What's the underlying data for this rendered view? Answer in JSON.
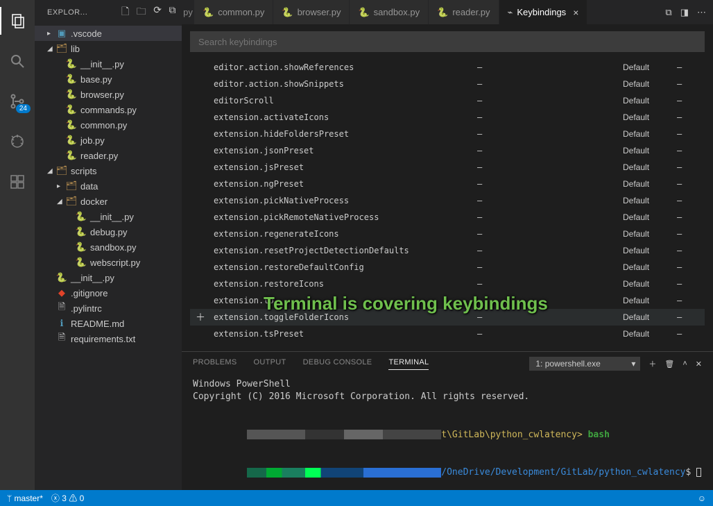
{
  "activityBar": {
    "badge": "24"
  },
  "sidebar": {
    "title": "EXPLOR...",
    "tree": [
      {
        "depth": 1,
        "chev": "▸",
        "icon": "folder-settings",
        "label": ".vscode",
        "sel": true,
        "iconColor": "#519aba"
      },
      {
        "depth": 1,
        "chev": "◢",
        "icon": "folder",
        "label": "lib"
      },
      {
        "depth": 2,
        "chev": "",
        "icon": "py",
        "label": "__init__.py"
      },
      {
        "depth": 2,
        "chev": "",
        "icon": "py",
        "label": "base.py"
      },
      {
        "depth": 2,
        "chev": "",
        "icon": "py",
        "label": "browser.py"
      },
      {
        "depth": 2,
        "chev": "",
        "icon": "py",
        "label": "commands.py"
      },
      {
        "depth": 2,
        "chev": "",
        "icon": "py",
        "label": "common.py"
      },
      {
        "depth": 2,
        "chev": "",
        "icon": "py",
        "label": "job.py"
      },
      {
        "depth": 2,
        "chev": "",
        "icon": "py",
        "label": "reader.py"
      },
      {
        "depth": 1,
        "chev": "◢",
        "icon": "folder",
        "label": "scripts"
      },
      {
        "depth": 2,
        "chev": "▸",
        "icon": "folder",
        "label": "data"
      },
      {
        "depth": 2,
        "chev": "◢",
        "icon": "folder",
        "label": "docker"
      },
      {
        "depth": 3,
        "chev": "",
        "icon": "py",
        "label": "__init__.py"
      },
      {
        "depth": 3,
        "chev": "",
        "icon": "py",
        "label": "debug.py"
      },
      {
        "depth": 3,
        "chev": "",
        "icon": "py",
        "label": "sandbox.py"
      },
      {
        "depth": 3,
        "chev": "",
        "icon": "py",
        "label": "webscript.py"
      },
      {
        "depth": 1,
        "chev": "",
        "icon": "py",
        "label": "__init__.py"
      },
      {
        "depth": 1,
        "chev": "",
        "icon": "git",
        "label": ".gitignore",
        "iconColor": "#e24329"
      },
      {
        "depth": 1,
        "chev": "",
        "icon": "file",
        "label": ".pylintrc"
      },
      {
        "depth": 1,
        "chev": "",
        "icon": "readme",
        "label": "README.md",
        "iconColor": "#519aba"
      },
      {
        "depth": 1,
        "chev": "",
        "icon": "file",
        "label": "requirements.txt"
      }
    ]
  },
  "tabs": {
    "scrollHint": "py",
    "items": [
      {
        "label": "common.py",
        "icon": "py",
        "active": false
      },
      {
        "label": "browser.py",
        "icon": "py",
        "active": false
      },
      {
        "label": "sandbox.py",
        "icon": "py",
        "active": false
      },
      {
        "label": "reader.py",
        "icon": "py",
        "active": false
      },
      {
        "label": "Keybindings",
        "icon": "kb",
        "active": true,
        "closable": true
      }
    ]
  },
  "keybindings": {
    "searchPlaceholder": "Search keybindings",
    "rows": [
      {
        "cmd": "editor.action.showReferences",
        "key": "—",
        "src": "Default",
        "when": "—"
      },
      {
        "cmd": "editor.action.showSnippets",
        "key": "—",
        "src": "Default",
        "when": "—"
      },
      {
        "cmd": "editorScroll",
        "key": "—",
        "src": "Default",
        "when": "—"
      },
      {
        "cmd": "extension.activateIcons",
        "key": "—",
        "src": "Default",
        "when": "—"
      },
      {
        "cmd": "extension.hideFoldersPreset",
        "key": "—",
        "src": "Default",
        "when": "—"
      },
      {
        "cmd": "extension.jsonPreset",
        "key": "—",
        "src": "Default",
        "when": "—"
      },
      {
        "cmd": "extension.jsPreset",
        "key": "—",
        "src": "Default",
        "when": "—"
      },
      {
        "cmd": "extension.ngPreset",
        "key": "—",
        "src": "Default",
        "when": "—"
      },
      {
        "cmd": "extension.pickNativeProcess",
        "key": "—",
        "src": "Default",
        "when": "—"
      },
      {
        "cmd": "extension.pickRemoteNativeProcess",
        "key": "—",
        "src": "Default",
        "when": "—"
      },
      {
        "cmd": "extension.regenerateIcons",
        "key": "—",
        "src": "Default",
        "when": "—"
      },
      {
        "cmd": "extension.resetProjectDetectionDefaults",
        "key": "—",
        "src": "Default",
        "when": "—"
      },
      {
        "cmd": "extension.restoreDefaultConfig",
        "key": "—",
        "src": "Default",
        "when": "—"
      },
      {
        "cmd": "extension.restoreIcons",
        "key": "—",
        "src": "Default",
        "when": "—"
      },
      {
        "cmd": "extension.to",
        "key": "—",
        "src": "Default",
        "when": "—"
      },
      {
        "cmd": "extension.toggleFolderIcons",
        "key": "—",
        "src": "Default",
        "when": "—",
        "hovered": true
      },
      {
        "cmd": "extension.tsPreset",
        "key": "—",
        "src": "Default",
        "when": "—"
      }
    ]
  },
  "panel": {
    "tabs": [
      "PROBLEMS",
      "OUTPUT",
      "DEBUG CONSOLE",
      "TERMINAL"
    ],
    "activeTab": 3,
    "termSelect": "1: powershell.exe",
    "lines": {
      "l1": "Windows PowerShell",
      "l2": "Copyright (C) 2016 Microsoft Corporation. All rights reserved.",
      "prompt1_path": "t\\GitLab\\python_cwlatency>",
      "prompt1_cmd": " bash",
      "prompt2_path": "/OneDrive/Development/GitLab/python_cwlatency",
      "prompt2_dollar": "$"
    }
  },
  "statusbar": {
    "branch": "master*",
    "errors": "3",
    "warnings": "0"
  },
  "overlay": "Terminal is covering keybindings"
}
